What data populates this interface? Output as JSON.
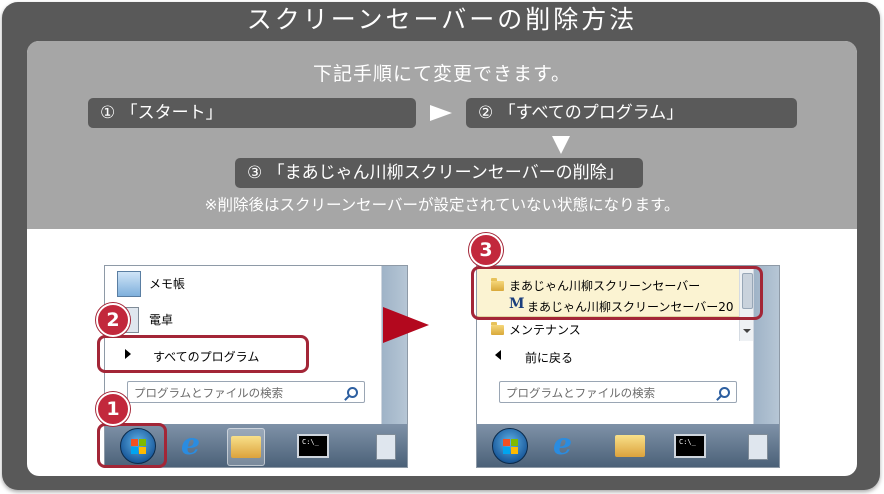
{
  "title": "スクリーンセーバーの削除方法",
  "subtitle": "下記手順にて変更できます。",
  "steps": {
    "step1": "① 「スタート」",
    "step2": "② 「すべてのプログラム」",
    "step3": "③ 「まあじゃん川柳スクリーンセーバーの削除」"
  },
  "note": "※削除後はスクリーンセーバーが設定されていない状態になります。",
  "badges": {
    "b1": "1",
    "b2": "2",
    "b3": "3"
  },
  "left_menu": {
    "item_notepad": "メモ帳",
    "item_calculator": "電卓",
    "all_programs": "すべてのプログラム",
    "search_placeholder": "プログラムとファイルの検索"
  },
  "right_menu": {
    "folder": "まあじゃん川柳スクリーンセーバー",
    "uninstall": "まあじゃん川柳スクリーンセーバー20",
    "maintenance": "メンテナンス",
    "back": "前に戻る",
    "search_placeholder": "プログラムとファイルの検索",
    "m_glyph": "M"
  },
  "taskbar": {
    "cmd_text": "C:\\_"
  },
  "colors": {
    "frame": "#595959",
    "gray_band": "#a6a6a6",
    "pill": "#5a5a5a",
    "highlight_red": "#a32637",
    "badge_red": "#c2283c",
    "arrow_red": "#b3081e"
  }
}
